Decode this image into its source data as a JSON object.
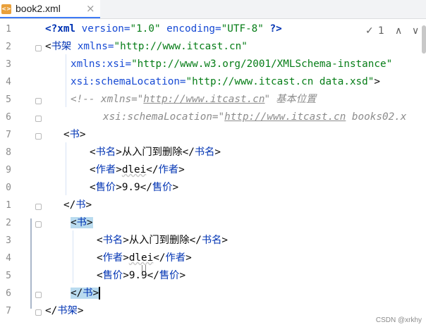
{
  "tab": {
    "icon_label": "<>",
    "title": "book2.xml",
    "close": "×"
  },
  "inspection": {
    "check": "✓",
    "count": "1",
    "up": "∧",
    "down": "∨"
  },
  "line_numbers": [
    "1",
    "2",
    "3",
    "4",
    "5",
    "6",
    "7",
    "8",
    "9",
    "0",
    "1",
    "2",
    "3",
    "4",
    "5",
    "6",
    "7"
  ],
  "code": {
    "l1": {
      "open": "<?",
      "name": "xml",
      "a1": " version=",
      "v1": "\"1.0\"",
      "a2": " encoding=",
      "v2": "\"UTF-8\"",
      "close": " ?>"
    },
    "l2": {
      "open": "<",
      "name": "书架",
      "a1": " xmlns=",
      "v1": "\"http://www.itcast.cn\""
    },
    "l3": {
      "a1": "xmlns:xsi=",
      "v1": "\"http://www.w3.org/2001/XMLSchema-instance\""
    },
    "l4": {
      "a1": "xsi:schemaLocation=",
      "v1": "\"http://www.itcast.cn data.xsd\"",
      "close": ">"
    },
    "l5": {
      "c1": "<!-- xmlns=\"",
      "u": "http://www.itcast.cn",
      "c2": "\"  基本位置"
    },
    "l6": {
      "c1": "xsi:schemaLocation=\"",
      "u": "http://www.itcast.cn",
      "c2": " books02.x"
    },
    "l7": {
      "open": "<",
      "name": "书",
      "close": ">"
    },
    "l8": {
      "o1": "<",
      "n1": "书名",
      "c1": ">",
      "text": "从入门到删除",
      "o2": "</",
      "n2": "书名",
      "c2": ">"
    },
    "l9": {
      "o1": "<",
      "n1": "作者",
      "c1": ">",
      "text": "dlei",
      "o2": "</",
      "n2": "作者",
      "c2": ">"
    },
    "l10": {
      "o1": "<",
      "n1": "售价",
      "c1": ">",
      "text": "9.9",
      "o2": "</",
      "n2": "售价",
      "c2": ">"
    },
    "l11": {
      "open": "</",
      "name": "书",
      "close": ">"
    },
    "l12": {
      "open": "<",
      "name": "书",
      "close": ">"
    },
    "l13": {
      "o1": "<",
      "n1": "书名",
      "c1": ">",
      "text": "从入门到删除",
      "o2": "</",
      "n2": "书名",
      "c2": ">"
    },
    "l14": {
      "o1": "<",
      "n1": "作者",
      "c1": ">",
      "text": "dlei",
      "o2": "</",
      "n2": "作者",
      "c2": ">"
    },
    "l15": {
      "o1": "<",
      "n1": "售价",
      "c1": ">",
      "text": "9.9",
      "o2": "</",
      "n2": "售价",
      "c2": ">"
    },
    "l16": {
      "open": "</",
      "name": "书",
      "close": ">"
    },
    "l17": {
      "open": "</",
      "name": "书架",
      "close": ">"
    }
  },
  "watermark": "CSDN @xrkhy",
  "colors": {
    "tag": "#0033b3",
    "attr_value": "#067d17",
    "comment": "#8c8c8c",
    "highlight": "#b9dbef"
  }
}
